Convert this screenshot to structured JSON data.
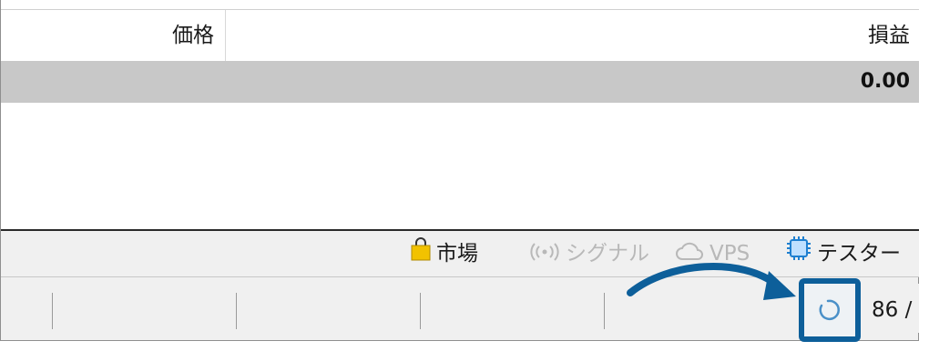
{
  "table": {
    "columns": {
      "price": "価格",
      "profit": "損益"
    },
    "total_profit": "0.00"
  },
  "tabs": [
    {
      "label": "市場",
      "icon": "shopping-bag-icon",
      "enabled": true
    },
    {
      "label": "シグナル",
      "icon": "signal-broadcast-icon",
      "enabled": false
    },
    {
      "label": "VPS",
      "icon": "cloud-icon",
      "enabled": false
    },
    {
      "label": "テスター",
      "icon": "chip-icon",
      "enabled": true
    }
  ],
  "status_bar": {
    "connection_text": "86 /",
    "loading_icon": "loading-spinner-icon"
  },
  "colors": {
    "highlight": "#0d5f9a",
    "bag": "#f2c200",
    "chip": "#1e7fd0"
  }
}
